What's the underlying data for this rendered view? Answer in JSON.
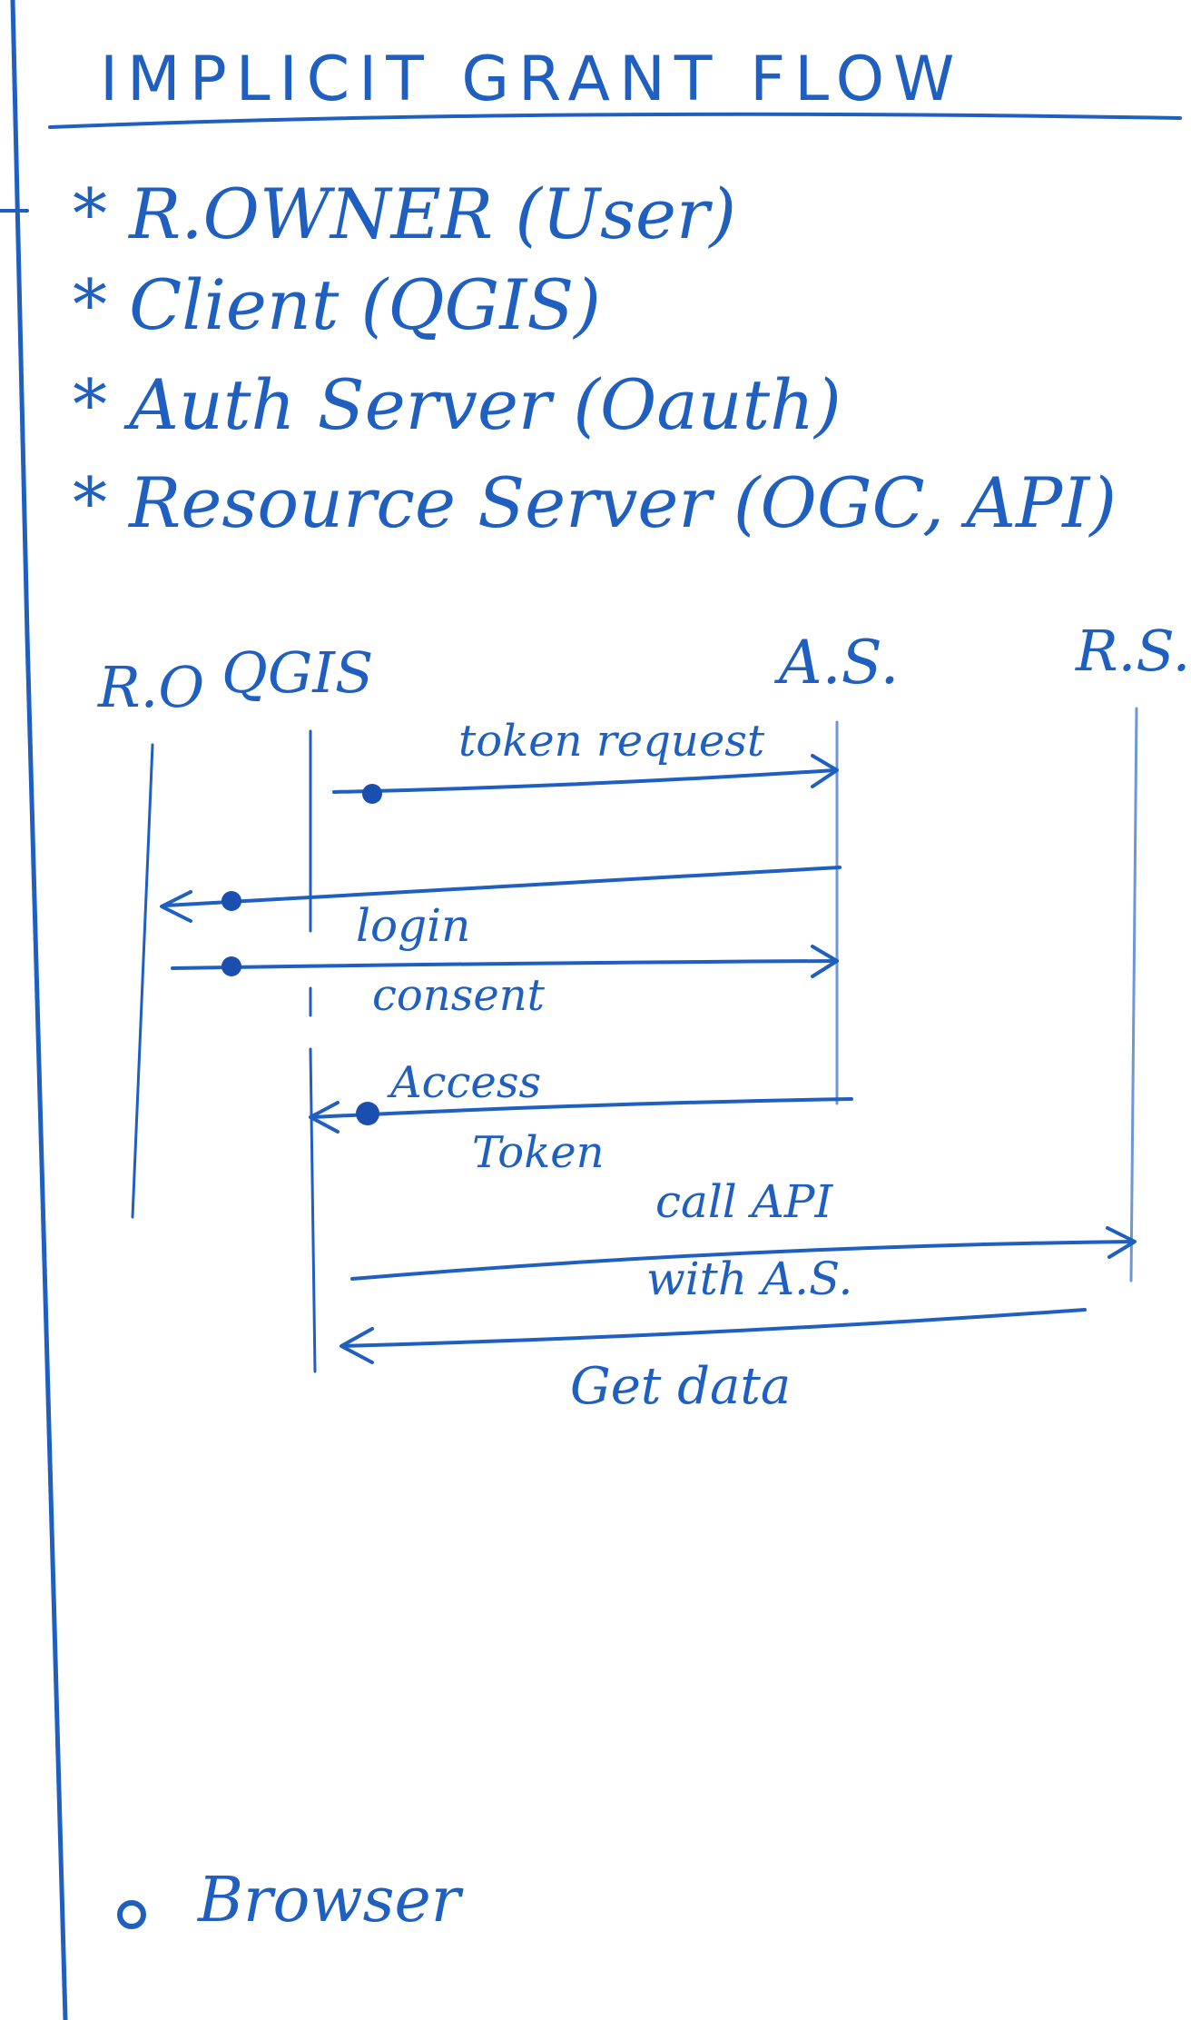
{
  "title": "IMPLICIT GRANT FLOW",
  "roles": [
    "* R.OWNER (User)",
    "* Client (QGIS)",
    "* Auth Server (Oauth)",
    "* Resource Server (OGC, API)"
  ],
  "lanes": {
    "ro": "R.O",
    "client": "QGIS",
    "as": "A.S.",
    "rs": "R.S."
  },
  "messages": {
    "token_request": "token request",
    "login": "login",
    "consent": "consent",
    "access": "Access",
    "token": "Token",
    "call_api": "call API",
    "with_as": "with A.S.",
    "get_data": "Get data"
  },
  "note": "Browser"
}
